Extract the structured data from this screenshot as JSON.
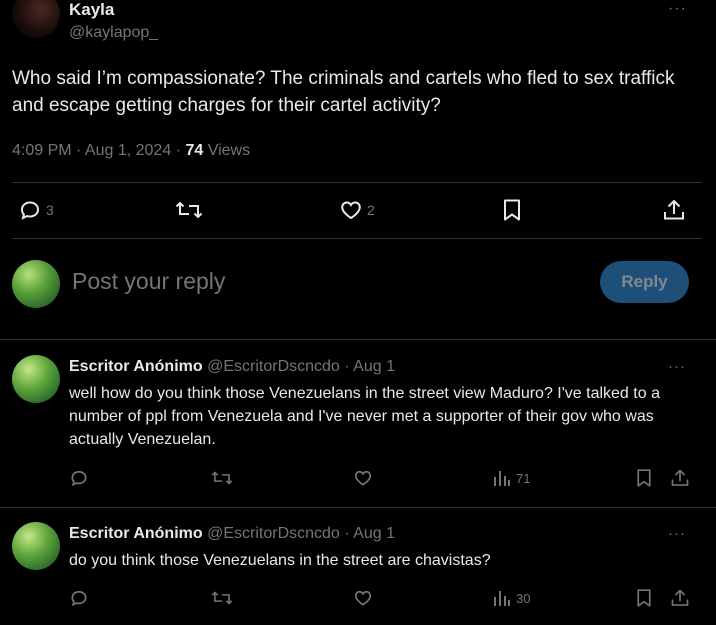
{
  "post": {
    "name": "Kayla",
    "handle": "@kaylapop_",
    "more": "···",
    "text": "Who said I’m compassionate? The criminals and cartels who fled to sex traffick and escape getting charges for their cartel activity?",
    "time": "4:09 PM · Aug 1, 2024 ·",
    "views_count": "74",
    "views_label": "Views",
    "reply_count": "3",
    "like_count": "2"
  },
  "composer": {
    "placeholder": "Post your reply",
    "button": "Reply"
  },
  "replies": [
    {
      "name": "Escritor Anónimo",
      "handle": "@EscritorDscncdo",
      "date": "· Aug 1",
      "text": "well how do you think those Venezuelans in the street view Maduro? I've talked to a number of ppl from Venezuela and I've never met a supporter of their gov who was actually Venezuelan.",
      "views": "71"
    },
    {
      "name": "Escritor Anónimo",
      "handle": "@EscritorDscncdo",
      "date": "· Aug 1",
      "text": "do you think those Venezuelans in the street are chavistas?",
      "views": "30"
    }
  ],
  "colors": {
    "background": "#000000",
    "text": "#e7e9ea",
    "muted": "#71767b",
    "separator": "#2f3336",
    "reply_button": "#1d4f78"
  }
}
